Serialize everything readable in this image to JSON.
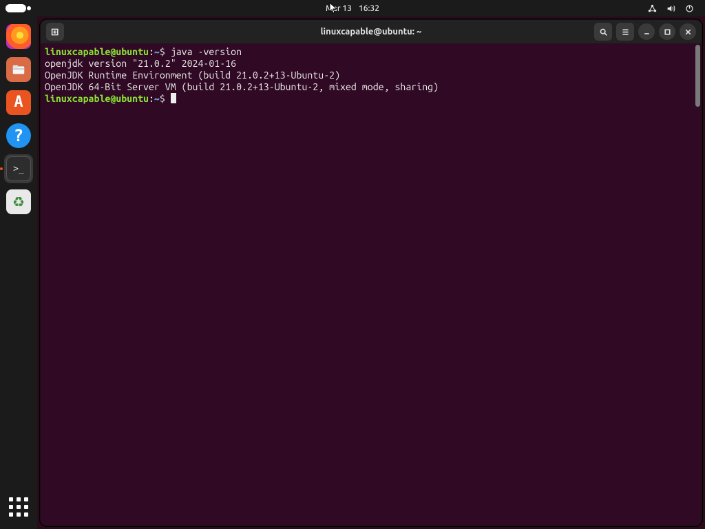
{
  "top_panel": {
    "date": "Mar 13",
    "time": "16:32"
  },
  "dock": {
    "items": [
      {
        "name": "firefox",
        "label": "Firefox"
      },
      {
        "name": "files",
        "label": "Files"
      },
      {
        "name": "software",
        "label": "Ubuntu Software"
      },
      {
        "name": "help",
        "label": "Help"
      },
      {
        "name": "terminal",
        "label": "Terminal"
      },
      {
        "name": "trash",
        "label": "Trash"
      }
    ]
  },
  "terminal": {
    "title": "linuxcapable@ubuntu: ~",
    "prompt": {
      "user": "linuxcapable",
      "at": "@",
      "host": "ubuntu",
      "colon": ":",
      "path": "~",
      "dollar": "$"
    },
    "lines": [
      {
        "type": "prompt_cmd",
        "cmd": "java -version"
      },
      {
        "type": "out",
        "text": "openjdk version \"21.0.2\" 2024-01-16"
      },
      {
        "type": "out",
        "text": "OpenJDK Runtime Environment (build 21.0.2+13-Ubuntu-2)"
      },
      {
        "type": "out",
        "text": "OpenJDK 64-Bit Server VM (build 21.0.2+13-Ubuntu-2, mixed mode, sharing)"
      },
      {
        "type": "prompt_cursor"
      }
    ]
  },
  "icons": {
    "help_glyph": "?",
    "terminal_glyph": ">_",
    "trash_glyph": "♻",
    "software_glyph": "A",
    "files_glyph": "▭"
  }
}
